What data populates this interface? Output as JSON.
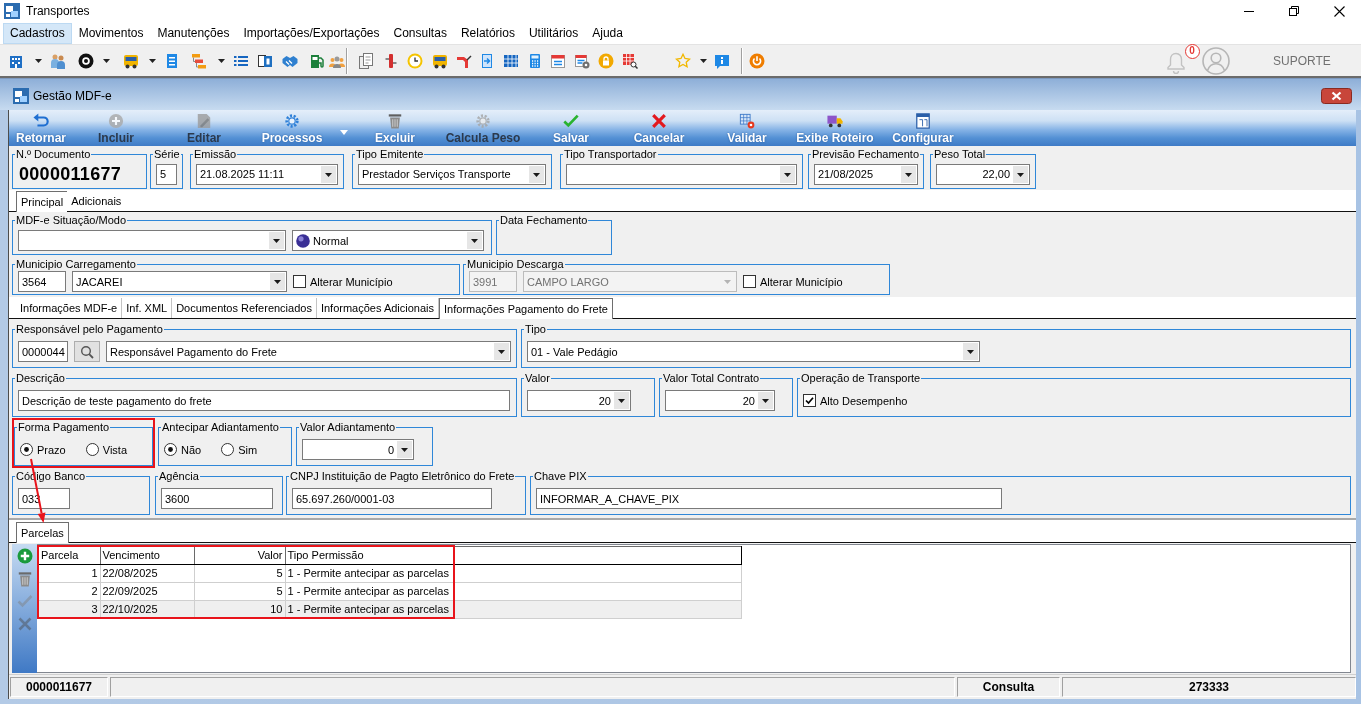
{
  "window": {
    "title": "Transportes"
  },
  "menu": [
    {
      "label": "Cadastros",
      "selected": true
    },
    {
      "label": "Movimentos",
      "selected": false
    },
    {
      "label": "Manutenções",
      "selected": false
    },
    {
      "label": "Importações/Exportações",
      "selected": false
    },
    {
      "label": "Consultas",
      "selected": false
    },
    {
      "label": "Relatórios",
      "selected": false
    },
    {
      "label": "Utilitários",
      "selected": false
    },
    {
      "label": "Ajuda",
      "selected": false
    }
  ],
  "toolbar": {
    "notification_count": "0",
    "user": "SUPORTE"
  },
  "document_window": {
    "title": "Gestão MDF-e"
  },
  "actions": [
    {
      "label": "Retornar",
      "disabled": false,
      "dropdown": false
    },
    {
      "label": "Incluir",
      "disabled": true,
      "dropdown": false
    },
    {
      "label": "Editar",
      "disabled": true,
      "dropdown": false
    },
    {
      "label": "Processos",
      "disabled": false,
      "dropdown": true
    },
    {
      "label": "Excluir",
      "disabled": false,
      "dropdown": false
    },
    {
      "label": "Calcula Peso",
      "disabled": true,
      "dropdown": false
    },
    {
      "label": "Salvar",
      "disabled": false,
      "dropdown": false
    },
    {
      "label": "Cancelar",
      "disabled": false,
      "dropdown": false
    },
    {
      "label": "Validar",
      "disabled": false,
      "dropdown": false
    },
    {
      "label": "Exibe Roteiro",
      "disabled": false,
      "dropdown": false
    },
    {
      "label": "Configurar",
      "disabled": false,
      "dropdown": false
    }
  ],
  "header_fields": [
    {
      "label": "N.º Documento",
      "controls": [
        {
          "kind": "display",
          "value": "0000011677"
        }
      ]
    },
    {
      "label": "Série",
      "controls": [
        {
          "kind": "text",
          "value": "5"
        }
      ]
    },
    {
      "label": "Emissão",
      "controls": [
        {
          "kind": "combo",
          "value": "21.08.2025 11:11"
        }
      ]
    },
    {
      "label": "Tipo Emitente",
      "controls": [
        {
          "kind": "combo",
          "value": "Prestador Serviços Transporte"
        }
      ]
    },
    {
      "label": "Tipo Transportador",
      "controls": [
        {
          "kind": "combo"
        }
      ]
    },
    {
      "label": "Previsão Fechamento",
      "controls": [
        {
          "kind": "combo",
          "value": "21/08/2025"
        }
      ]
    },
    {
      "label": "Peso Total",
      "controls": [
        {
          "kind": "combo",
          "value": "22,00"
        }
      ]
    }
  ],
  "main_tabs": [
    {
      "label": "Principal",
      "selected": true
    },
    {
      "label": "Adicionais",
      "selected": false
    }
  ],
  "principal": [
    [
      {
        "label": "MDF-e Situação/Modo",
        "controls": [
          {
            "kind": "combo"
          },
          {
            "kind": "status_combo",
            "value": "Normal"
          }
        ]
      },
      {
        "label": "Data Fechamento"
      }
    ],
    [
      {
        "label": "Municipio Carregamento",
        "controls": [
          {
            "kind": "text",
            "value": "3564",
            "disabled": false
          },
          {
            "kind": "combo",
            "value": "JACAREI",
            "disabled": false
          },
          {
            "kind": "checkbox",
            "label": "Alterar Município",
            "checked": false
          }
        ]
      },
      {
        "label": "Municipio Descarga",
        "controls": [
          {
            "kind": "text",
            "value": "3991",
            "disabled": true
          },
          {
            "kind": "combo",
            "value": "CAMPO LARGO",
            "disabled": true
          },
          {
            "kind": "checkbox",
            "label": "Alterar Município",
            "checked": false
          }
        ]
      }
    ]
  ],
  "detail_tabs": [
    {
      "label": "Informações MDF-e",
      "selected": false
    },
    {
      "label": "Inf. XML",
      "selected": false
    },
    {
      "label": "Documentos Referenciados",
      "selected": false
    },
    {
      "label": "Informações Adicionais",
      "selected": false
    },
    {
      "label": "Informações Pagamento do Frete",
      "selected": true
    }
  ],
  "payment": [
    [
      {
        "label": "Responsável pelo Pagamento",
        "highlighted": false,
        "controls": [
          {
            "kind": "text",
            "value": "0000044"
          },
          {
            "kind": "lookup"
          },
          {
            "kind": "combo",
            "value": "Responsável Pagamento do Frete"
          }
        ]
      },
      {
        "label": "Tipo",
        "highlighted": false,
        "controls": [
          {
            "kind": "combo",
            "value": "01 - Vale Pedágio"
          }
        ]
      }
    ],
    [
      {
        "label": "Descrição",
        "highlighted": false,
        "controls": [
          {
            "kind": "text",
            "value": "Descrição de teste pagamento do frete"
          }
        ]
      },
      {
        "label": "Valor",
        "highlighted": false,
        "controls": [
          {
            "kind": "combo",
            "value": "20"
          }
        ]
      },
      {
        "label": "Valor Total Contrato",
        "highlighted": false,
        "controls": [
          {
            "kind": "combo",
            "value": "20"
          }
        ]
      },
      {
        "label": "Operação de Transporte",
        "highlighted": false,
        "controls": [
          {
            "kind": "checkbox",
            "label": "Alto Desempenho",
            "checked": true
          }
        ]
      }
    ],
    [
      {
        "label": "Forma Pagamento",
        "highlighted": true,
        "controls": [
          {
            "kind": "radio",
            "label": "Prazo",
            "selected": true
          },
          {
            "kind": "radio",
            "label": "Vista",
            "selected": false
          }
        ]
      },
      {
        "label": "Antecipar Adiantamento",
        "highlighted": false,
        "controls": [
          {
            "kind": "radio",
            "label": "Não",
            "selected": true
          },
          {
            "kind": "radio",
            "label": "Sim",
            "selected": false
          }
        ]
      },
      {
        "label": "Valor Adiantamento",
        "highlighted": false,
        "controls": [
          {
            "kind": "combo",
            "value": "0"
          }
        ]
      }
    ],
    [
      {
        "label": "Código Banco",
        "highlighted": false,
        "controls": [
          {
            "kind": "text",
            "value": "033"
          }
        ]
      },
      {
        "label": "Agência",
        "highlighted": false,
        "controls": [
          {
            "kind": "text",
            "value": "3600"
          }
        ]
      },
      {
        "label": "CNPJ Instituição de Pagto Eletrônico do Frete",
        "highlighted": false,
        "controls": [
          {
            "kind": "text",
            "value": "65.697.260/0001-03"
          }
        ]
      },
      {
        "label": "Chave PIX",
        "highlighted": false,
        "controls": [
          {
            "kind": "text",
            "value": "INFORMAR_A_CHAVE_PIX"
          }
        ]
      }
    ]
  ],
  "parcelas": {
    "tabs": [
      {
        "label": "Parcelas",
        "selected": true
      }
    ],
    "side_buttons": [
      {
        "disabled": false
      },
      {
        "disabled": false
      },
      {
        "disabled": true
      },
      {
        "disabled": true
      }
    ],
    "columns": [
      {
        "label": "Parcela",
        "highlighted": true
      },
      {
        "label": "Vencimento",
        "highlighted": true
      },
      {
        "label": "Valor",
        "highlighted": true
      },
      {
        "label": "Tipo Permissão",
        "highlighted": true
      }
    ],
    "rows": [
      {
        "cells": [
          "1",
          "22/08/2025",
          "5",
          "1 - Permite antecipar as parcelas"
        ],
        "selected": false
      },
      {
        "cells": [
          "2",
          "22/09/2025",
          "5",
          "1 - Permite antecipar as parcelas"
        ],
        "selected": false
      },
      {
        "cells": [
          "3",
          "22/10/2025",
          "10",
          "1 - Permite antecipar as parcelas"
        ],
        "selected": true
      }
    ]
  },
  "status_bar": [
    "0000011677",
    "Consulta",
    "273333"
  ],
  "annotation_arrow": true
}
